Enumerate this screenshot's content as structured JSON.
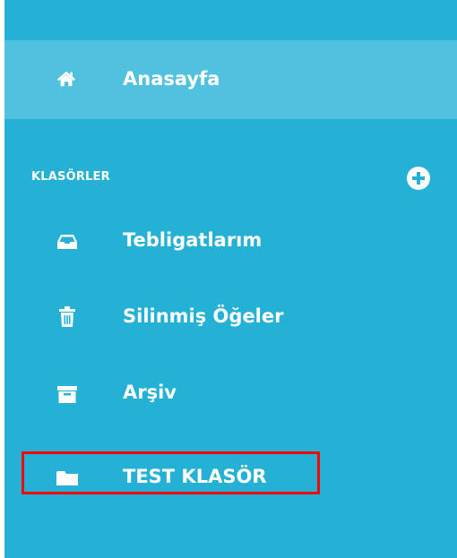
{
  "sidebar": {
    "home": {
      "label": "Anasayfa",
      "icon": "home-icon"
    },
    "section_title": "KLASÖRLER",
    "add_icon": "plus-circle-icon",
    "folders": [
      {
        "label": "Tebligatlarım",
        "icon": "inbox-icon"
      },
      {
        "label": "Silinmiş Öğeler",
        "icon": "trash-icon"
      },
      {
        "label": "Arşiv",
        "icon": "archive-icon"
      },
      {
        "label": "TEST KLASÖR",
        "icon": "folder-icon",
        "highlighted": true
      }
    ]
  },
  "colors": {
    "sidebar_bg": "#25b0d6",
    "active_bg": "#51c1e0",
    "text": "#ffffff",
    "highlight": "#ff0000"
  }
}
